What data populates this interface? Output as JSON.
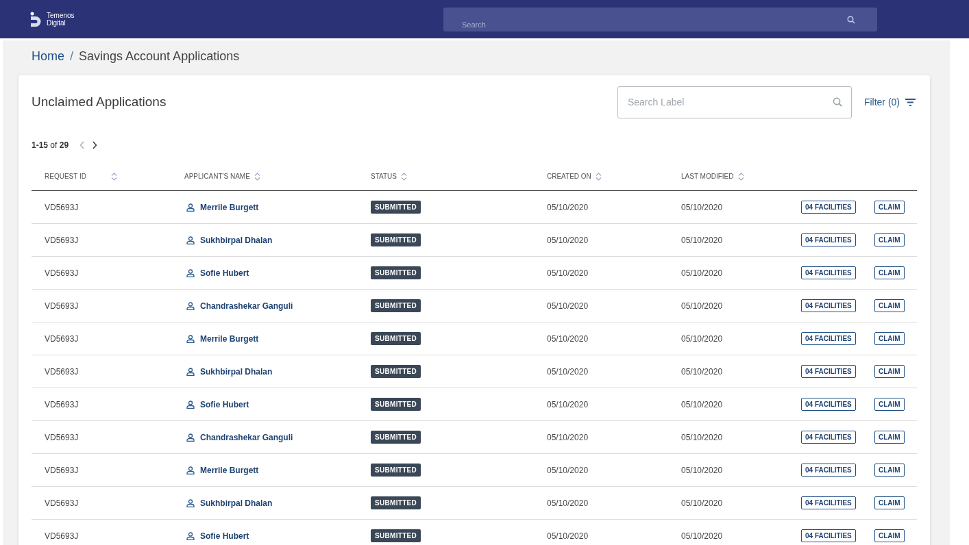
{
  "header": {
    "logo_text": [
      "Temenos",
      "Digital"
    ],
    "search": {
      "placeholder": "Search"
    }
  },
  "breadcrumb_separator": "/",
  "breadcrumb": [
    {
      "label": "Home",
      "kind": "link"
    },
    {
      "label": "Savings Account Applications",
      "kind": "current"
    }
  ],
  "card": {
    "title": "Unclaimed Applications",
    "search": {
      "placeholder": "Search Label"
    },
    "filter": "Filter (0)",
    "pagination": {
      "range": "1-15",
      "of": "of",
      "total": "29",
      "prev_disabled": true
    },
    "table": {
      "columns": [
        "REQUEST ID",
        "APPLICANT'S NAME",
        "STATUS",
        "CREATED ON",
        "LAST MODIFIED"
      ],
      "rows": [
        {
          "request_id": "VD5693J",
          "name": "Merrile Burgett",
          "status": "SUBMITTED",
          "created_on": "05/10/2020",
          "last_modified": "05/10/2020",
          "facilities": "04 FACILITIES",
          "action": "CLAIM"
        },
        {
          "request_id": "VD5693J",
          "name": "Sukhbirpal Dhalan",
          "status": "SUBMITTED",
          "created_on": "05/10/2020",
          "last_modified": "05/10/2020",
          "facilities": "04 FACILITIES",
          "action": "CLAIM"
        },
        {
          "request_id": "VD5693J",
          "name": "Sofie Hubert",
          "status": "SUBMITTED",
          "created_on": "05/10/2020",
          "last_modified": "05/10/2020",
          "facilities": "04 FACILITIES",
          "action": "CLAIM"
        },
        {
          "request_id": "VD5693J",
          "name": "Chandrashekar Ganguli",
          "status": "SUBMITTED",
          "created_on": "05/10/2020",
          "last_modified": "05/10/2020",
          "facilities": "04 FACILITIES",
          "action": "CLAIM"
        },
        {
          "request_id": "VD5693J",
          "name": "Merrile Burgett",
          "status": "SUBMITTED",
          "created_on": "05/10/2020",
          "last_modified": "05/10/2020",
          "facilities": "04 FACILITIES",
          "action": "CLAIM"
        },
        {
          "request_id": "VD5693J",
          "name": "Sukhbirpal Dhalan",
          "status": "SUBMITTED",
          "created_on": "05/10/2020",
          "last_modified": "05/10/2020",
          "facilities": "04 FACILITIES",
          "action": "CLAIM"
        },
        {
          "request_id": "VD5693J",
          "name": "Sofie Hubert",
          "status": "SUBMITTED",
          "created_on": "05/10/2020",
          "last_modified": "05/10/2020",
          "facilities": "04 FACILITIES",
          "action": "CLAIM"
        },
        {
          "request_id": "VD5693J",
          "name": "Chandrashekar Ganguli",
          "status": "SUBMITTED",
          "created_on": "05/10/2020",
          "last_modified": "05/10/2020",
          "facilities": "04 FACILITIES",
          "action": "CLAIM"
        },
        {
          "request_id": "VD5693J",
          "name": "Merrile Burgett",
          "status": "SUBMITTED",
          "created_on": "05/10/2020",
          "last_modified": "05/10/2020",
          "facilities": "04 FACILITIES",
          "action": "CLAIM"
        },
        {
          "request_id": "VD5693J",
          "name": "Sukhbirpal Dhalan",
          "status": "SUBMITTED",
          "created_on": "05/10/2020",
          "last_modified": "05/10/2020",
          "facilities": "04 FACILITIES",
          "action": "CLAIM"
        },
        {
          "request_id": "VD5693J",
          "name": "Sofie Hubert",
          "status": "SUBMITTED",
          "created_on": "05/10/2020",
          "last_modified": "05/10/2020",
          "facilities": "04 FACILITIES",
          "action": "CLAIM"
        }
      ]
    }
  }
}
